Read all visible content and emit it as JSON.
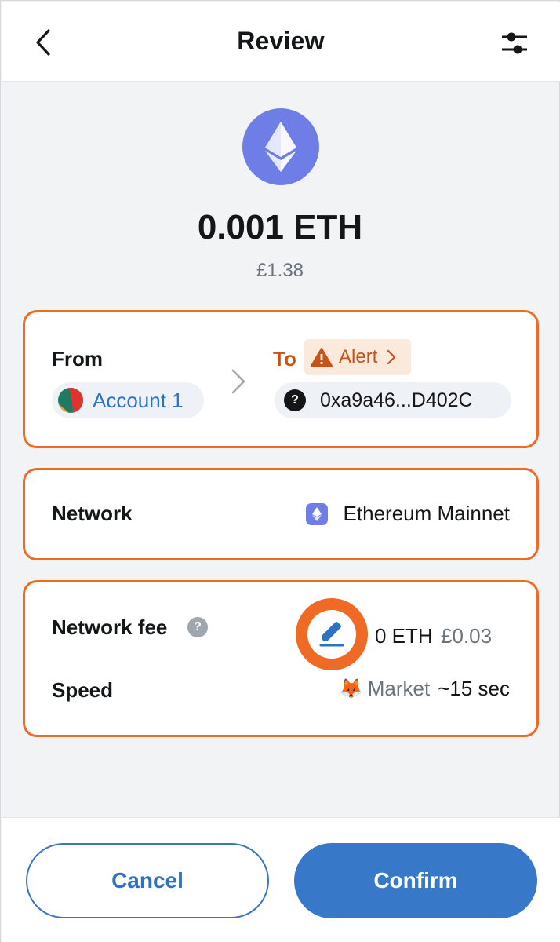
{
  "header": {
    "title": "Review",
    "back_icon": "chevron-left-icon",
    "settings_icon": "sliders-icon"
  },
  "amount": {
    "value": "0.001 ETH",
    "fiat": "£1.38",
    "token_icon": "ethereum-icon"
  },
  "transfer": {
    "from_label": "From",
    "from_account": "Account 1",
    "to_label": "To",
    "alert_label": "Alert",
    "to_address": "0xa9a46...D402C"
  },
  "network": {
    "label": "Network",
    "name": "Ethereum Mainnet"
  },
  "fee": {
    "label": "Network fee",
    "help_symbol": "?",
    "eth": "0 ETH",
    "fiat": "£0.03",
    "speed_label": "Speed",
    "speed_icon": "🦊",
    "speed_name": "Market",
    "speed_eta": "~15 sec"
  },
  "footer": {
    "cancel_label": "Cancel",
    "confirm_label": "Confirm"
  },
  "colors": {
    "accent": "#3778c9",
    "highlight": "#ee6a25",
    "alert": "#c5531a",
    "eth": "#6f7ee6"
  }
}
